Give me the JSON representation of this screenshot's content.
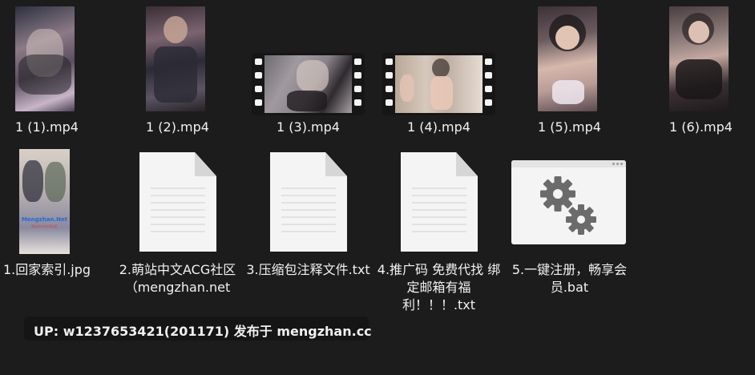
{
  "files": [
    {
      "name": "1 (1).mp4",
      "kind": "video-portrait"
    },
    {
      "name": "1 (2).mp4",
      "kind": "video-portrait"
    },
    {
      "name": "1 (3).mp4",
      "kind": "video-landscape"
    },
    {
      "name": "1 (4).mp4",
      "kind": "video-landscape"
    },
    {
      "name": "1 (5).mp4",
      "kind": "video-portrait"
    },
    {
      "name": "1 (6).mp4",
      "kind": "video-portrait"
    },
    {
      "name": "1.回家索引.jpg",
      "kind": "image",
      "thumb_text": [
        "Mengzhan.Net",
        "萌站中文ACG社区"
      ]
    },
    {
      "name": "2.萌站中文ACG社区（mengzhan.net",
      "kind": "text-document"
    },
    {
      "name": "3.压缩包注释文件.txt",
      "kind": "text-document"
    },
    {
      "name": "4.推广码 免费代找 绑定邮箱有福利！！！.txt",
      "kind": "text-document"
    },
    {
      "name": "5.一键注册，畅享会员.bat",
      "kind": "batch-file",
      "icon": "gears-icon"
    }
  ],
  "watermark": {
    "text": "UP: w1237653421(201171) 发布于 mengzhan.cc"
  },
  "colors": {
    "background": "#1c1c1c",
    "icon_paper": "#f4f4f4",
    "gear": "#6b6b6b"
  }
}
